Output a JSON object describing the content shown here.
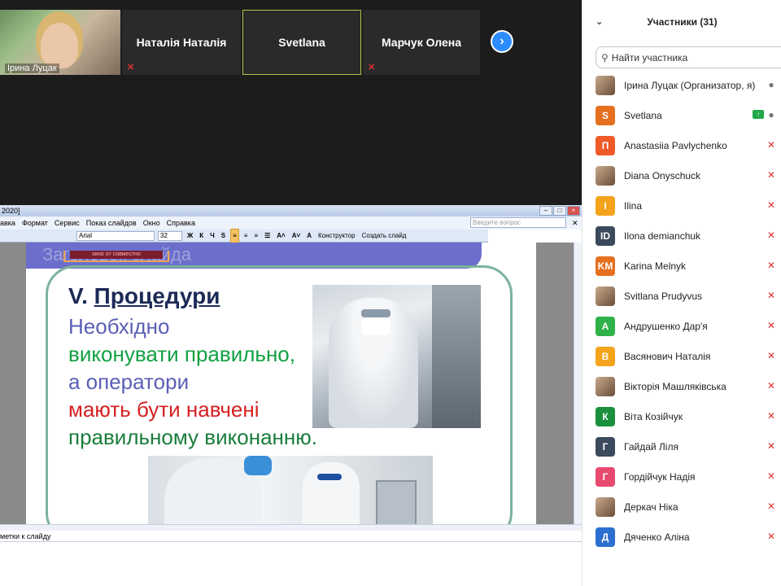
{
  "video": {
    "tiles": [
      {
        "name": "Ірина Луцак"
      },
      {
        "name": "Наталія Наталія"
      },
      {
        "name": "Svetlana"
      },
      {
        "name": "Марчук Олена"
      }
    ],
    "next_icon": "chevron-right-icon"
  },
  "ppt": {
    "title_fragment": "2020]",
    "menu": [
      "авка",
      "Формат",
      "Сервис",
      "Показ слайдов",
      "Окно",
      "Справка"
    ],
    "search_placeholder": "Введите вопрос",
    "font": "Arial",
    "size": "32",
    "toolbar": {
      "bold": "Ж",
      "italic": "К",
      "underline": "Ч",
      "shadow": "S",
      "constructor": "Конструктор",
      "create_slide": "Создать слайд"
    },
    "notes": "метки к слайду"
  },
  "slide": {
    "ghost_title": "Заголовок слайда",
    "orange_label": "окно от совместно",
    "heading_prefix": "V.",
    "heading_word": "Процедури",
    "lines": [
      "Необхідно",
      "виконувати правильно,",
      "а оператори",
      "мають бути навчені",
      "правильному виконанню."
    ],
    "colors": {
      "blue": "#5a5fb5",
      "green": "#12a042",
      "red": "#d62020",
      "dark_green": "#1a7d3c",
      "header_bg": "#6b6fcb"
    }
  },
  "panel": {
    "title": "Участники (31)",
    "search_placeholder": "Найти участника",
    "participants": [
      {
        "name": "Ірина Луцак (Организатор, я)",
        "avatar": "",
        "color": "",
        "status": "mic"
      },
      {
        "name": "Svetlana",
        "avatar": "S",
        "color": "#e5701f",
        "status": "mic-sharing"
      },
      {
        "name": "Anastasiia Pavlychenko",
        "avatar": "П",
        "color": "#f05a28",
        "status": "muted"
      },
      {
        "name": "Diana Onyschuck",
        "avatar": "",
        "color": "",
        "status": "muted"
      },
      {
        "name": "Ilina",
        "avatar": "I",
        "color": "#f4a31a",
        "status": "muted"
      },
      {
        "name": "Ilona demianchuk",
        "avatar": "ID",
        "color": "#3b4a5c",
        "status": "muted"
      },
      {
        "name": "Karina Melnyk",
        "avatar": "KM",
        "color": "#e5701f",
        "status": "muted"
      },
      {
        "name": "Svitlana Prudyvus",
        "avatar": "",
        "color": "",
        "status": "muted"
      },
      {
        "name": "Андрушенко Дар'я",
        "avatar": "А",
        "color": "#2fb24a",
        "status": "muted"
      },
      {
        "name": "Васянович Наталія",
        "avatar": "В",
        "color": "#f4a31a",
        "status": "muted"
      },
      {
        "name": "Вікторія Машляківська",
        "avatar": "",
        "color": "",
        "status": "muted"
      },
      {
        "name": "Віта Козійчук",
        "avatar": "К",
        "color": "#1a8f3c",
        "status": "muted"
      },
      {
        "name": "Гайдай Ліля",
        "avatar": "Г",
        "color": "#3b4a5c",
        "status": "muted"
      },
      {
        "name": "Гордійчук Надія",
        "avatar": "Г",
        "color": "#e84a6f",
        "status": "muted"
      },
      {
        "name": "Деркач Ніка",
        "avatar": "",
        "color": "",
        "status": "muted"
      },
      {
        "name": "Дяченко Аліна",
        "avatar": "Д",
        "color": "#2d6fd0",
        "status": "muted"
      }
    ]
  }
}
